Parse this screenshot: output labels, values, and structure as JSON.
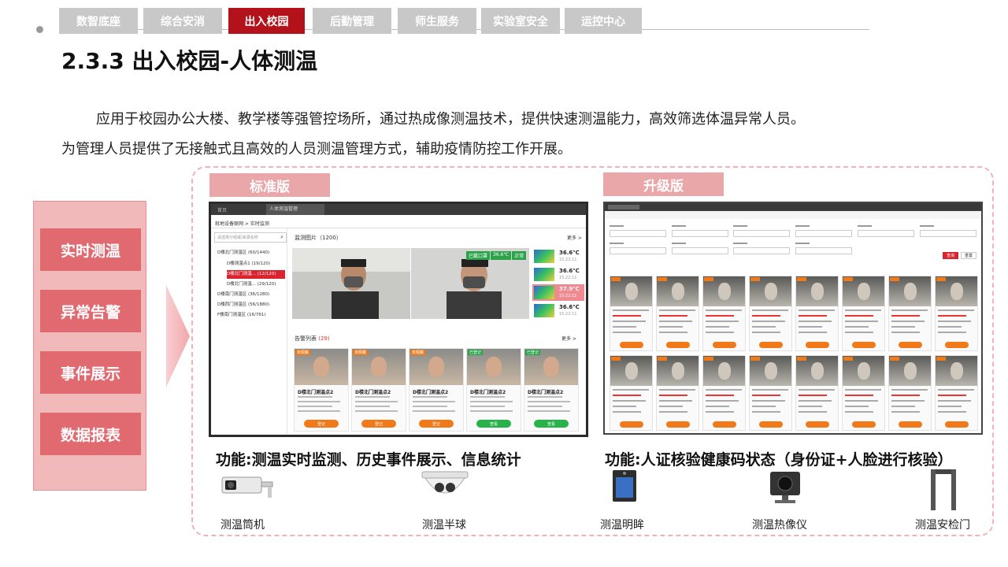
{
  "nav": {
    "tabs": [
      {
        "label": "数智底座",
        "active": false
      },
      {
        "label": "综合安消",
        "active": false
      },
      {
        "label": "出入校园",
        "active": true
      },
      {
        "label": "后勤管理",
        "active": false
      },
      {
        "label": "师生服务",
        "active": false
      },
      {
        "label": "实验室安全",
        "active": false
      },
      {
        "label": "运控中心",
        "active": false
      }
    ]
  },
  "page": {
    "title": "2.3.3 出入校园-人体测温",
    "para_line1": "应用于校园办公大楼、教学楼等强管控场所，通过热成像测温技术，提供快速测温能力，高效筛选体温异常人员。",
    "para_line2": "为管理人员提供了无接触式且高效的人员测温管理方式，辅助疫情防控工作开展。"
  },
  "features": [
    "实时测温",
    "异常告警",
    "事件展示",
    "数据报表"
  ],
  "standard": {
    "tag": "标准版",
    "func": "功能:测温实时监测、历史事件展示、信息统计",
    "window_tab1": "首页",
    "window_tab2": "人体测温管理",
    "breadcrumb": "就地设备联网 > 实时监测",
    "search_placeholder": "请选择分组或/来源名称",
    "tree": [
      "D楼北门测温区 (60/1440)",
      "D楼测温点1 (19/120)",
      "D楼北门测温... (12/120)",
      "D楼北门测温... (29/120)",
      "D楼南门测温区 (36/1280)",
      "D楼西门测温区 (56/1880)",
      "F楼南门测温区 (16/761)"
    ],
    "monitor_title": "监测图片（1200）",
    "more": "更多 >",
    "overlay": [
      "已戴口罩",
      "36.6℃",
      "正常"
    ],
    "temps": [
      "36.6℃",
      "36.6℃",
      "37.9℃",
      "36.6℃"
    ],
    "temp_times": [
      "15:22:11",
      "15:22:11",
      "15:22:11",
      "15:22:11"
    ],
    "alarm_title": "告警列表",
    "alarm_count": "(29)",
    "cards": [
      {
        "badge": "未佩戴",
        "name": "D楼北门测温点2",
        "btn": "登记",
        "btncolor": "#f07a1a"
      },
      {
        "badge": "未佩戴",
        "name": "D楼北门测温点2",
        "btn": "登记",
        "btncolor": "#f07a1a"
      },
      {
        "badge": "未佩戴",
        "name": "D楼北门测温点2",
        "btn": "登记",
        "btncolor": "#f07a1a"
      },
      {
        "badge": "已登记",
        "name": "D楼北门测温点2",
        "btn": "查看",
        "btncolor": "#27b34a"
      },
      {
        "badge": "已登记",
        "name": "D楼北门测温点2",
        "btn": "查看",
        "btncolor": "#27b34a"
      }
    ]
  },
  "upgrade": {
    "tag": "升级版",
    "func": "功能:人证核验健康码状态（身份证+人脸进行核验）",
    "btn_search": "查询",
    "btn_reset": "重置"
  },
  "devices": [
    "测温筒机",
    "测温半球",
    "测温明眸",
    "测温热像仪",
    "测温安检门"
  ],
  "colors": {
    "accent": "#b3121b",
    "pink": "#e16a71",
    "tab_gray": "#c8c8c8"
  }
}
